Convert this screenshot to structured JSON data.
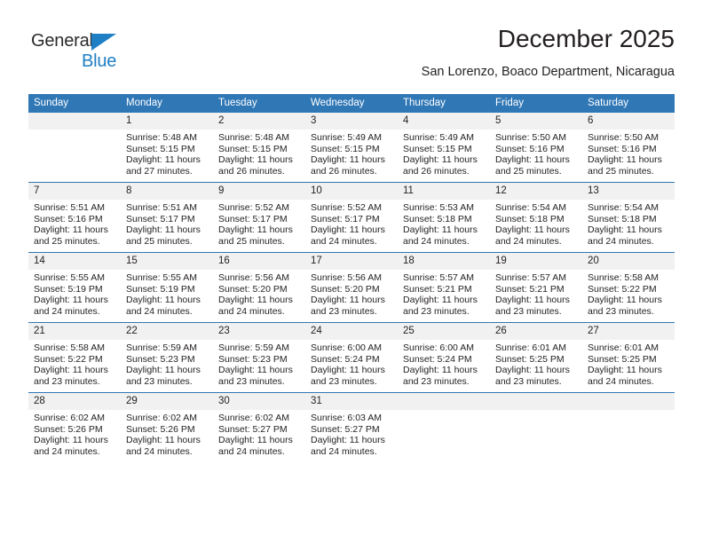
{
  "brand": {
    "name_line1": "General",
    "name_line2": "Blue",
    "accent_color": "#1f7fc4",
    "text_color": "#2b2b2b"
  },
  "header": {
    "title": "December 2025",
    "subtitle": "San Lorenzo, Boaco Department, Nicaragua"
  },
  "theme": {
    "header_bg": "#3077b5",
    "daynum_bg": "#f1f1f1",
    "grid_line": "#3077b5",
    "text": "#231f20"
  },
  "calendar": {
    "weekday_headers": [
      "Sunday",
      "Monday",
      "Tuesday",
      "Wednesday",
      "Thursday",
      "Friday",
      "Saturday"
    ],
    "weeks": [
      [
        {
          "day": "",
          "empty": true,
          "sunrise": "",
          "sunset": "",
          "daylight_line1": "",
          "daylight_line2": ""
        },
        {
          "day": "1",
          "sunrise": "Sunrise: 5:48 AM",
          "sunset": "Sunset: 5:15 PM",
          "daylight_line1": "Daylight: 11 hours",
          "daylight_line2": "and 27 minutes."
        },
        {
          "day": "2",
          "sunrise": "Sunrise: 5:48 AM",
          "sunset": "Sunset: 5:15 PM",
          "daylight_line1": "Daylight: 11 hours",
          "daylight_line2": "and 26 minutes."
        },
        {
          "day": "3",
          "sunrise": "Sunrise: 5:49 AM",
          "sunset": "Sunset: 5:15 PM",
          "daylight_line1": "Daylight: 11 hours",
          "daylight_line2": "and 26 minutes."
        },
        {
          "day": "4",
          "sunrise": "Sunrise: 5:49 AM",
          "sunset": "Sunset: 5:15 PM",
          "daylight_line1": "Daylight: 11 hours",
          "daylight_line2": "and 26 minutes."
        },
        {
          "day": "5",
          "sunrise": "Sunrise: 5:50 AM",
          "sunset": "Sunset: 5:16 PM",
          "daylight_line1": "Daylight: 11 hours",
          "daylight_line2": "and 25 minutes."
        },
        {
          "day": "6",
          "sunrise": "Sunrise: 5:50 AM",
          "sunset": "Sunset: 5:16 PM",
          "daylight_line1": "Daylight: 11 hours",
          "daylight_line2": "and 25 minutes."
        }
      ],
      [
        {
          "day": "7",
          "sunrise": "Sunrise: 5:51 AM",
          "sunset": "Sunset: 5:16 PM",
          "daylight_line1": "Daylight: 11 hours",
          "daylight_line2": "and 25 minutes."
        },
        {
          "day": "8",
          "sunrise": "Sunrise: 5:51 AM",
          "sunset": "Sunset: 5:17 PM",
          "daylight_line1": "Daylight: 11 hours",
          "daylight_line2": "and 25 minutes."
        },
        {
          "day": "9",
          "sunrise": "Sunrise: 5:52 AM",
          "sunset": "Sunset: 5:17 PM",
          "daylight_line1": "Daylight: 11 hours",
          "daylight_line2": "and 25 minutes."
        },
        {
          "day": "10",
          "sunrise": "Sunrise: 5:52 AM",
          "sunset": "Sunset: 5:17 PM",
          "daylight_line1": "Daylight: 11 hours",
          "daylight_line2": "and 24 minutes."
        },
        {
          "day": "11",
          "sunrise": "Sunrise: 5:53 AM",
          "sunset": "Sunset: 5:18 PM",
          "daylight_line1": "Daylight: 11 hours",
          "daylight_line2": "and 24 minutes."
        },
        {
          "day": "12",
          "sunrise": "Sunrise: 5:54 AM",
          "sunset": "Sunset: 5:18 PM",
          "daylight_line1": "Daylight: 11 hours",
          "daylight_line2": "and 24 minutes."
        },
        {
          "day": "13",
          "sunrise": "Sunrise: 5:54 AM",
          "sunset": "Sunset: 5:18 PM",
          "daylight_line1": "Daylight: 11 hours",
          "daylight_line2": "and 24 minutes."
        }
      ],
      [
        {
          "day": "14",
          "sunrise": "Sunrise: 5:55 AM",
          "sunset": "Sunset: 5:19 PM",
          "daylight_line1": "Daylight: 11 hours",
          "daylight_line2": "and 24 minutes."
        },
        {
          "day": "15",
          "sunrise": "Sunrise: 5:55 AM",
          "sunset": "Sunset: 5:19 PM",
          "daylight_line1": "Daylight: 11 hours",
          "daylight_line2": "and 24 minutes."
        },
        {
          "day": "16",
          "sunrise": "Sunrise: 5:56 AM",
          "sunset": "Sunset: 5:20 PM",
          "daylight_line1": "Daylight: 11 hours",
          "daylight_line2": "and 24 minutes."
        },
        {
          "day": "17",
          "sunrise": "Sunrise: 5:56 AM",
          "sunset": "Sunset: 5:20 PM",
          "daylight_line1": "Daylight: 11 hours",
          "daylight_line2": "and 23 minutes."
        },
        {
          "day": "18",
          "sunrise": "Sunrise: 5:57 AM",
          "sunset": "Sunset: 5:21 PM",
          "daylight_line1": "Daylight: 11 hours",
          "daylight_line2": "and 23 minutes."
        },
        {
          "day": "19",
          "sunrise": "Sunrise: 5:57 AM",
          "sunset": "Sunset: 5:21 PM",
          "daylight_line1": "Daylight: 11 hours",
          "daylight_line2": "and 23 minutes."
        },
        {
          "day": "20",
          "sunrise": "Sunrise: 5:58 AM",
          "sunset": "Sunset: 5:22 PM",
          "daylight_line1": "Daylight: 11 hours",
          "daylight_line2": "and 23 minutes."
        }
      ],
      [
        {
          "day": "21",
          "sunrise": "Sunrise: 5:58 AM",
          "sunset": "Sunset: 5:22 PM",
          "daylight_line1": "Daylight: 11 hours",
          "daylight_line2": "and 23 minutes."
        },
        {
          "day": "22",
          "sunrise": "Sunrise: 5:59 AM",
          "sunset": "Sunset: 5:23 PM",
          "daylight_line1": "Daylight: 11 hours",
          "daylight_line2": "and 23 minutes."
        },
        {
          "day": "23",
          "sunrise": "Sunrise: 5:59 AM",
          "sunset": "Sunset: 5:23 PM",
          "daylight_line1": "Daylight: 11 hours",
          "daylight_line2": "and 23 minutes."
        },
        {
          "day": "24",
          "sunrise": "Sunrise: 6:00 AM",
          "sunset": "Sunset: 5:24 PM",
          "daylight_line1": "Daylight: 11 hours",
          "daylight_line2": "and 23 minutes."
        },
        {
          "day": "25",
          "sunrise": "Sunrise: 6:00 AM",
          "sunset": "Sunset: 5:24 PM",
          "daylight_line1": "Daylight: 11 hours",
          "daylight_line2": "and 23 minutes."
        },
        {
          "day": "26",
          "sunrise": "Sunrise: 6:01 AM",
          "sunset": "Sunset: 5:25 PM",
          "daylight_line1": "Daylight: 11 hours",
          "daylight_line2": "and 23 minutes."
        },
        {
          "day": "27",
          "sunrise": "Sunrise: 6:01 AM",
          "sunset": "Sunset: 5:25 PM",
          "daylight_line1": "Daylight: 11 hours",
          "daylight_line2": "and 24 minutes."
        }
      ],
      [
        {
          "day": "28",
          "sunrise": "Sunrise: 6:02 AM",
          "sunset": "Sunset: 5:26 PM",
          "daylight_line1": "Daylight: 11 hours",
          "daylight_line2": "and 24 minutes."
        },
        {
          "day": "29",
          "sunrise": "Sunrise: 6:02 AM",
          "sunset": "Sunset: 5:26 PM",
          "daylight_line1": "Daylight: 11 hours",
          "daylight_line2": "and 24 minutes."
        },
        {
          "day": "30",
          "sunrise": "Sunrise: 6:02 AM",
          "sunset": "Sunset: 5:27 PM",
          "daylight_line1": "Daylight: 11 hours",
          "daylight_line2": "and 24 minutes."
        },
        {
          "day": "31",
          "sunrise": "Sunrise: 6:03 AM",
          "sunset": "Sunset: 5:27 PM",
          "daylight_line1": "Daylight: 11 hours",
          "daylight_line2": "and 24 minutes."
        },
        {
          "day": "",
          "empty": true,
          "sunrise": "",
          "sunset": "",
          "daylight_line1": "",
          "daylight_line2": ""
        },
        {
          "day": "",
          "empty": true,
          "sunrise": "",
          "sunset": "",
          "daylight_line1": "",
          "daylight_line2": ""
        },
        {
          "day": "",
          "empty": true,
          "sunrise": "",
          "sunset": "",
          "daylight_line1": "",
          "daylight_line2": ""
        }
      ]
    ]
  }
}
